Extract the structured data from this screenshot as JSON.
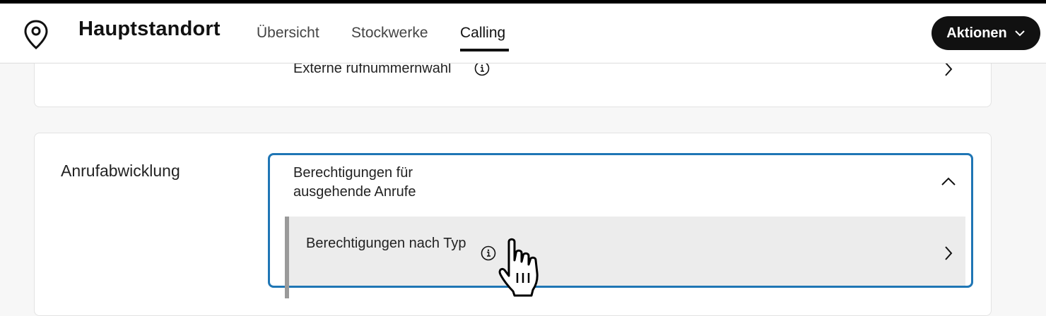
{
  "header": {
    "title": "Hauptstandort",
    "tabs": [
      {
        "label": "Übersicht",
        "active": false
      },
      {
        "label": "Stockwerke",
        "active": false
      },
      {
        "label": "Calling",
        "active": true
      }
    ],
    "actions_label": "Aktionen"
  },
  "card1": {
    "row_label": "Externe rufnummernwahl"
  },
  "call_handling": {
    "section_title": "Anrufabwicklung",
    "expanded_item_label": "Berechtigungen für ausgehende Anrufe",
    "sub_item_label": "Berechtigungen nach Typ"
  },
  "icons": [
    "location-pin-icon",
    "chevron-down-icon",
    "info-icon",
    "chevron-right-icon",
    "chevron-up-icon",
    "hand-cursor-icon"
  ],
  "colors": {
    "accent_focus": "#1f76b5",
    "button_bg": "#111111",
    "page_bg": "#f7f7f7"
  }
}
